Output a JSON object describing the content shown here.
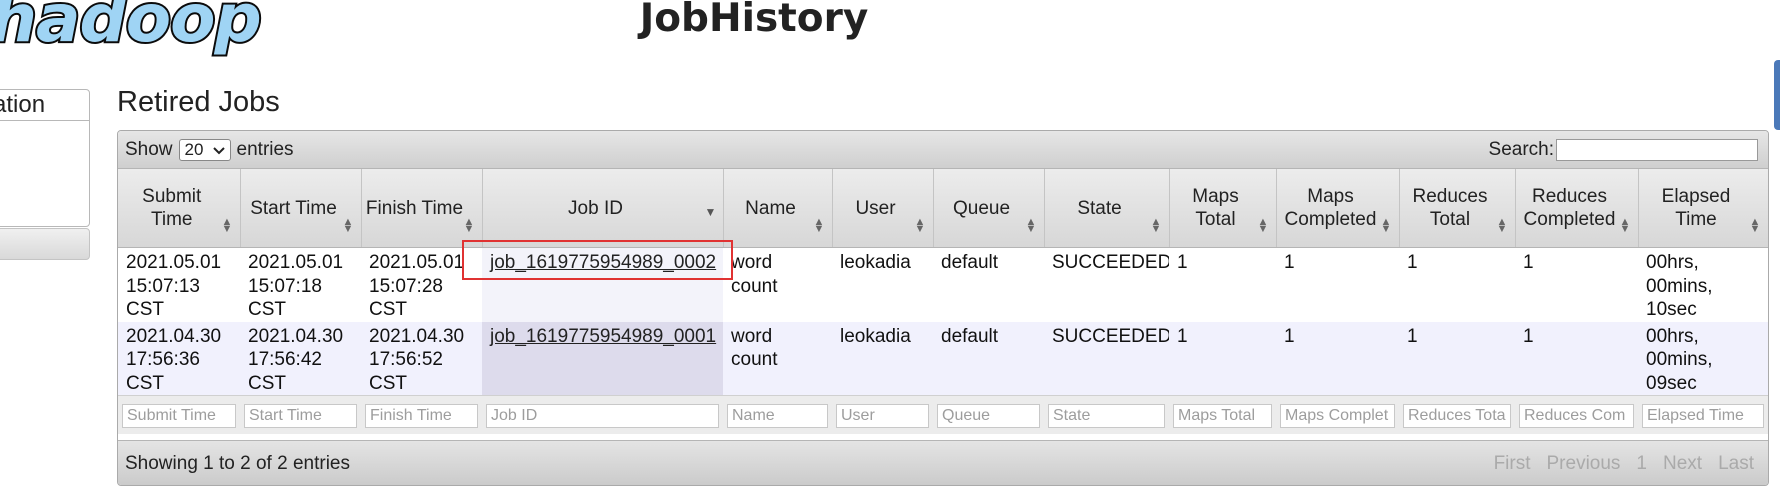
{
  "header": {
    "logo_text": "hadoop",
    "app_title": "JobHistory"
  },
  "nav": {
    "section_label": "ation"
  },
  "section_title": "Retired Jobs",
  "toolbar": {
    "show_label": "Show",
    "page_length": "20",
    "entries_label": "entries",
    "search_label": "Search:"
  },
  "columns": [
    {
      "line1": "Submit",
      "line2": "Time"
    },
    {
      "line1": "Start Time",
      "line2": ""
    },
    {
      "line1": "Finish Time",
      "line2": ""
    },
    {
      "line1": "Job ID",
      "line2": ""
    },
    {
      "line1": "Name",
      "line2": ""
    },
    {
      "line1": "User",
      "line2": ""
    },
    {
      "line1": "Queue",
      "line2": ""
    },
    {
      "line1": "State",
      "line2": ""
    },
    {
      "line1": "Maps",
      "line2": "Total"
    },
    {
      "line1": "Maps",
      "line2": "Completed"
    },
    {
      "line1": "Reduces",
      "line2": "Total"
    },
    {
      "line1": "Reduces",
      "line2": "Completed"
    },
    {
      "line1": "Elapsed",
      "line2": "Time"
    }
  ],
  "rows": [
    {
      "submit_time": [
        "2021.05.01",
        "15:07:13",
        "CST"
      ],
      "start_time": [
        "2021.05.01",
        "15:07:18",
        "CST"
      ],
      "finish_time": [
        "2021.05.01",
        "15:07:28",
        "CST"
      ],
      "job_id": "job_1619775954989_0002",
      "name": [
        "word",
        "count"
      ],
      "user": "leokadia",
      "queue": "default",
      "state": "SUCCEEDED",
      "maps_total": "1",
      "maps_completed": "1",
      "reduces_total": "1",
      "reduces_completed": "1",
      "elapsed": [
        "00hrs,",
        "00mins,",
        "10sec"
      ]
    },
    {
      "submit_time": [
        "2021.04.30",
        "17:56:36",
        "CST"
      ],
      "start_time": [
        "2021.04.30",
        "17:56:42",
        "CST"
      ],
      "finish_time": [
        "2021.04.30",
        "17:56:52",
        "CST"
      ],
      "job_id": "job_1619775954989_0001",
      "name": [
        "word",
        "count"
      ],
      "user": "leokadia",
      "queue": "default",
      "state": "SUCCEEDED",
      "maps_total": "1",
      "maps_completed": "1",
      "reduces_total": "1",
      "reduces_completed": "1",
      "elapsed": [
        "00hrs,",
        "00mins,",
        "09sec"
      ]
    }
  ],
  "filters": [
    "Submit Time",
    "Start Time",
    "Finish Time",
    "Job ID",
    "Name",
    "User",
    "Queue",
    "State",
    "Maps Total",
    "Maps Complet",
    "Reduces Tota",
    "Reduces Com",
    "Elapsed Time"
  ],
  "footer": {
    "info": "Showing 1 to 2 of 2 entries",
    "first": "First",
    "previous": "Previous",
    "page": "1",
    "next": "Next",
    "last": "Last"
  },
  "colors": {
    "highlight": "#e03232",
    "logo_fill": "#9fd4f4",
    "sorted_column_alt": "#dddbec",
    "alt_row": "#f1f1fd"
  }
}
